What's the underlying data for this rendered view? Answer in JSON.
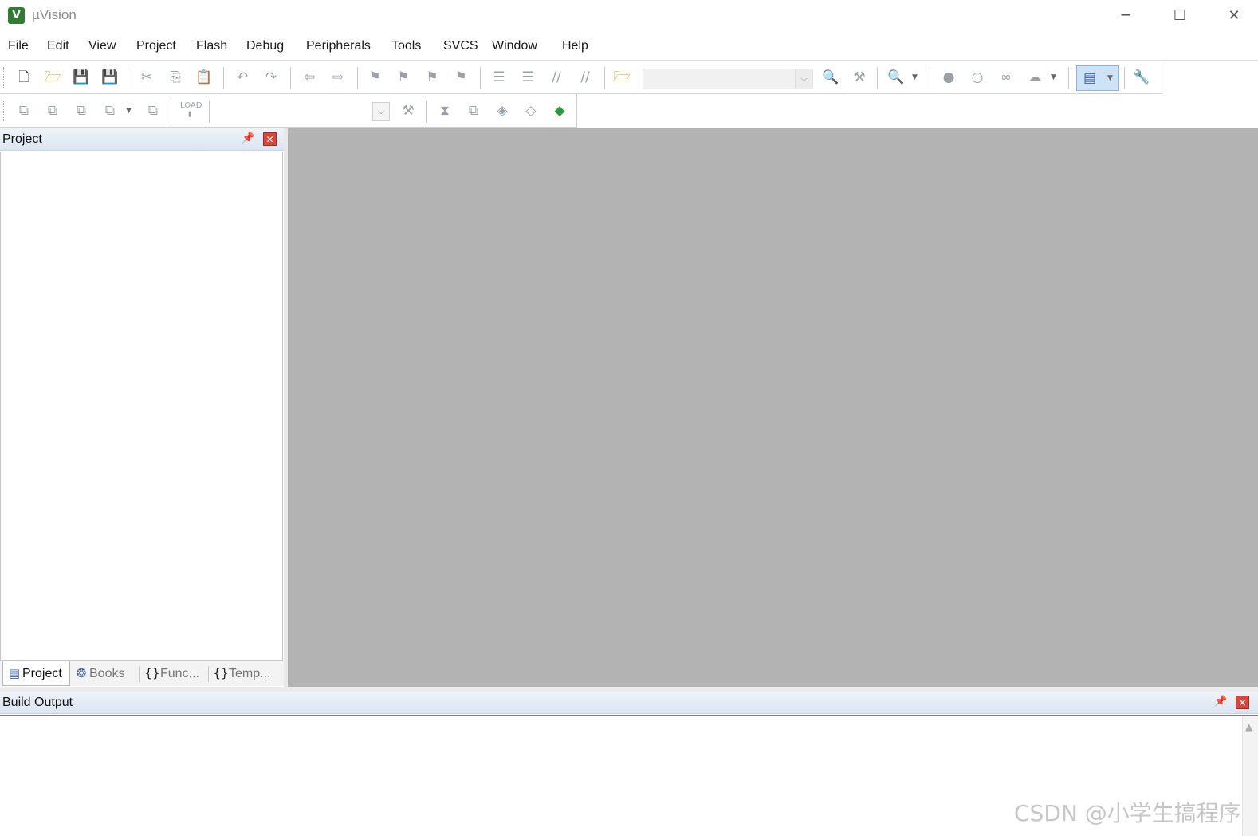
{
  "window": {
    "title": "µVision",
    "icon_letter": "V",
    "minimize": "─",
    "maximize": "☐",
    "close": "✕"
  },
  "menu": [
    "File",
    "Edit",
    "View",
    "Project",
    "Flash",
    "Debug",
    "Peripherals",
    "Tools",
    "SVCS",
    "Window",
    "Help"
  ],
  "toolbar": {
    "load_label": "LOAD",
    "target_combo_value": ""
  },
  "project_panel": {
    "title": "Project",
    "pin": "📌",
    "close": "✕",
    "tabs": [
      {
        "icon": "▤",
        "label": "Project"
      },
      {
        "icon": "❂",
        "label": "Books"
      },
      {
        "icon": "{}",
        "label": "Func..."
      },
      {
        "icon": "{}",
        "label": "Temp..."
      }
    ]
  },
  "build_output": {
    "title": "Build Output",
    "pin": "📌",
    "close": "✕",
    "scroll_up": "▲"
  },
  "watermark": "CSDN @小学生搞程序",
  "colors": {
    "editor_background": "#b3b3b3",
    "close_button": "#d9463a",
    "panel_header": "#dbe5f1"
  }
}
